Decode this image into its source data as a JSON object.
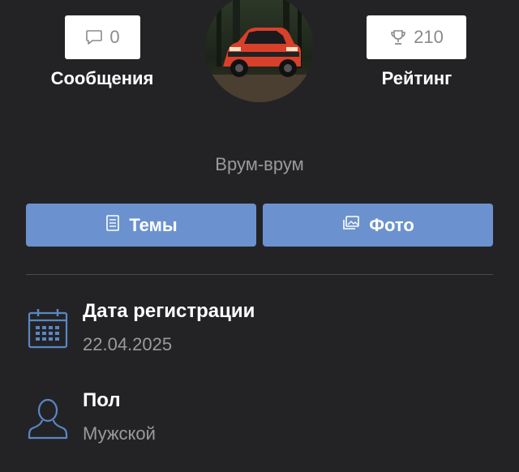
{
  "stats": {
    "messages": {
      "count": "0",
      "label": "Сообщения",
      "icon": "chat-bubble-icon"
    },
    "rating": {
      "count": "210",
      "label": "Рейтинг",
      "icon": "trophy-icon"
    }
  },
  "profile": {
    "avatar": "avatar-photo-red-suv",
    "status": "Врум-врум"
  },
  "actions": {
    "topics_label": "Темы",
    "photos_label": "Фото",
    "accent_color": "#6b92cf"
  },
  "info": {
    "registration": {
      "title": "Дата регистрации",
      "value": "22.04.2025",
      "icon": "calendar-icon"
    },
    "gender": {
      "title": "Пол",
      "value": "Мужской",
      "icon": "user-icon"
    }
  }
}
